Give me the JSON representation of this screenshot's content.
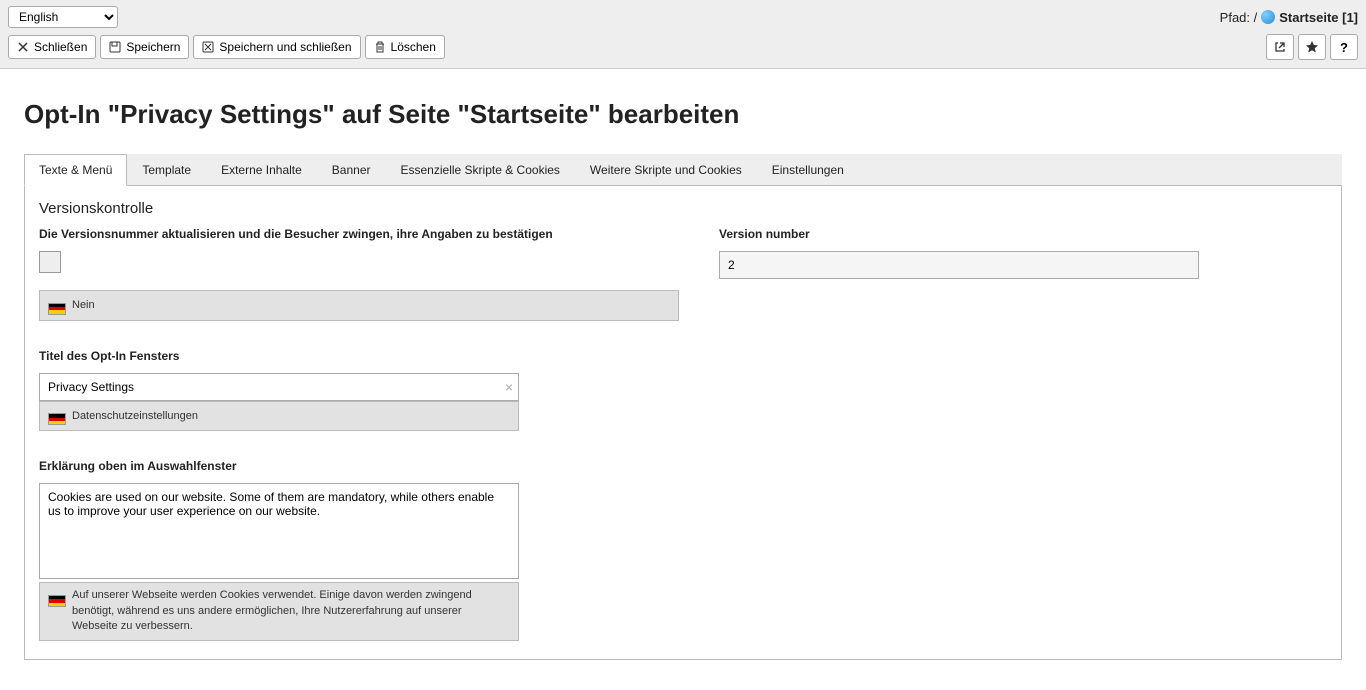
{
  "topbar": {
    "language_selected": "English",
    "path_prefix": "Pfad: /",
    "path_title": "Startseite [1]",
    "buttons": {
      "close": "Schließen",
      "save": "Speichern",
      "save_close": "Speichern und schließen",
      "delete": "Löschen"
    }
  },
  "page": {
    "title": "Opt-In \"Privacy Settings\" auf Seite \"Startseite\" bearbeiten"
  },
  "tabs": [
    "Texte & Menü",
    "Template",
    "Externe Inhalte",
    "Banner",
    "Essenzielle Skripte & Cookies",
    "Weitere Skripte und Cookies",
    "Einstellungen"
  ],
  "section1": {
    "heading": "Versionskontrolle",
    "left_label": "Die Versionsnummer aktualisieren und die Besucher zwingen, ihre Angaben zu bestätigen",
    "left_de_text": "Nein",
    "right_label": "Version number",
    "right_value": "2"
  },
  "section2": {
    "label": "Titel des Opt-In Fensters",
    "value": "Privacy Settings",
    "de_text": "Datenschutzeinstellungen"
  },
  "section3": {
    "label": "Erklärung oben im Auswahlfenster",
    "value": "Cookies are used on our website. Some of them are mandatory, while others enable us to improve your user experience on our website.",
    "de_text": "Auf unserer Webseite werden Cookies verwendet. Einige davon werden zwingend benötigt, während es uns andere ermöglichen, Ihre Nutzererfahrung auf unserer Webseite zu verbessern."
  }
}
